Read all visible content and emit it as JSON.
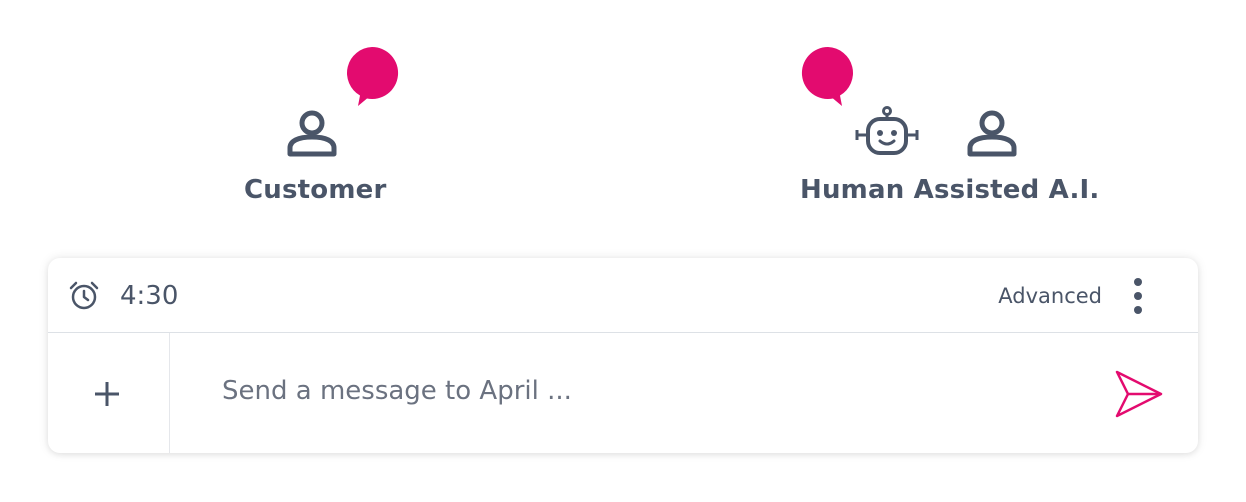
{
  "roles": {
    "customer": {
      "label": "Customer",
      "icons": [
        "speech-bubble-icon",
        "person-icon"
      ]
    },
    "assistant": {
      "label": "Human Assisted A.I.",
      "icons": [
        "speech-bubble-icon",
        "robot-icon",
        "person-icon"
      ]
    }
  },
  "composer": {
    "timer_icon": "alarm-clock-icon",
    "timer": "4:30",
    "advanced_label": "Advanced",
    "more_icon": "more-vertical-icon",
    "add_icon": "plus-icon",
    "placeholder": "Send a message to April ...",
    "send_icon": "send-icon"
  },
  "colors": {
    "accent": "#e30b6f",
    "text": "#4a5568",
    "divider": "#dde1e6"
  }
}
